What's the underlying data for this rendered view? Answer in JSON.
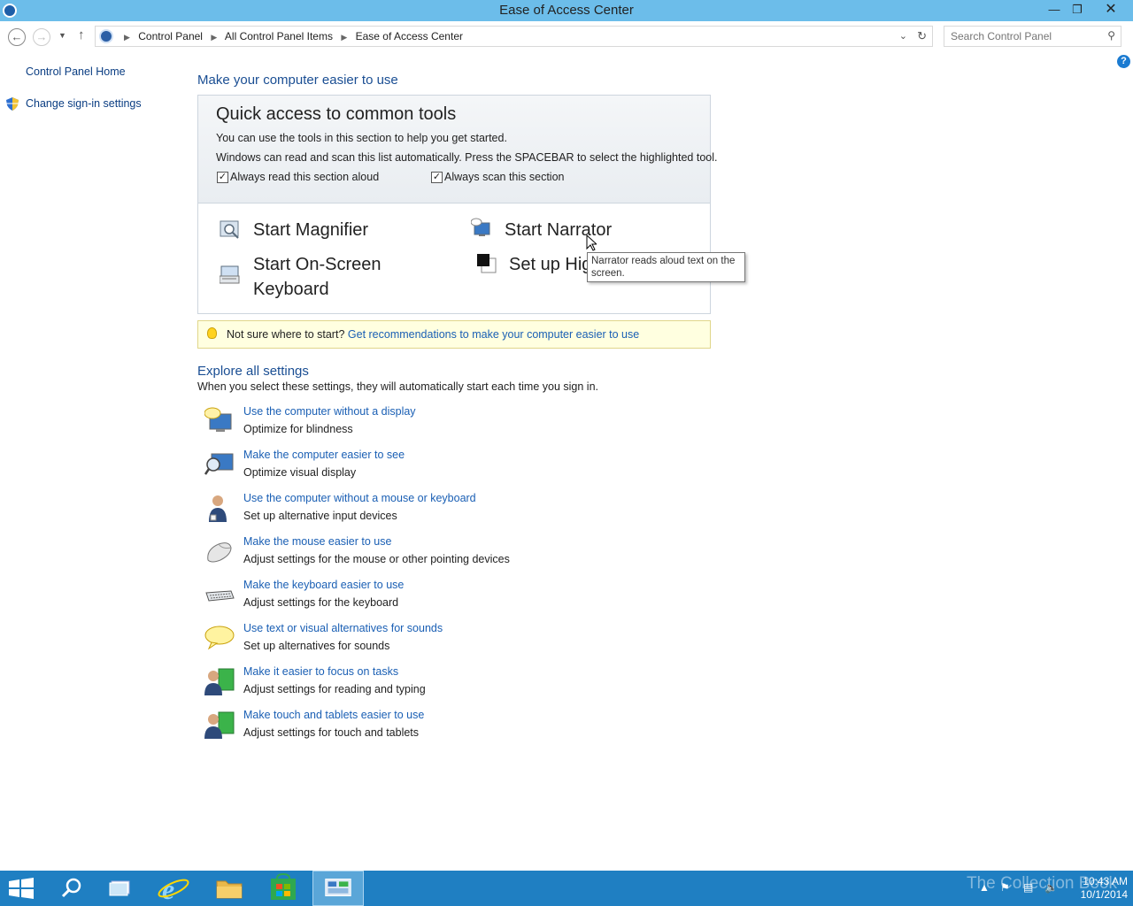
{
  "window": {
    "title": "Ease of Access Center"
  },
  "breadcrumbs": [
    "Control Panel",
    "All Control Panel Items",
    "Ease of Access Center"
  ],
  "search": {
    "placeholder": "Search Control Panel"
  },
  "left_pane": {
    "home": "Control Panel Home",
    "signin": "Change sign-in settings"
  },
  "main": {
    "heading": "Make your computer easier to use",
    "quick": {
      "title": "Quick access to common tools",
      "line1": "You can use the tools in this section to help you get started.",
      "line2": "Windows can read and scan this list automatically.  Press the SPACEBAR to select the highlighted tool.",
      "check_read": "Always read this section aloud",
      "check_scan": "Always scan this section",
      "tools": {
        "magnifier": "Start Magnifier",
        "narrator": "Start Narrator",
        "osk_line1": "Start On-Screen",
        "osk_line2": "Keyboard",
        "highcontrast": "Set up High Contrast"
      }
    },
    "tooltip": "Narrator reads aloud text on the screen.",
    "tip": {
      "prefix": "Not sure where to start?",
      "link": "Get recommendations to make your computer easier to use"
    },
    "explore": {
      "heading": "Explore all settings",
      "sub": "When you select these settings, they will automatically start each time you sign in.",
      "items": [
        {
          "link": "Use the computer without a display",
          "desc": "Optimize for blindness"
        },
        {
          "link": "Make the computer easier to see",
          "desc": "Optimize visual display"
        },
        {
          "link": "Use the computer without a mouse or keyboard",
          "desc": "Set up alternative input devices"
        },
        {
          "link": "Make the mouse easier to use",
          "desc": "Adjust settings for the mouse or other pointing devices"
        },
        {
          "link": "Make the keyboard easier to use",
          "desc": "Adjust settings for the keyboard"
        },
        {
          "link": "Use text or visual alternatives for sounds",
          "desc": "Set up alternatives for sounds"
        },
        {
          "link": "Make it easier to focus on tasks",
          "desc": "Adjust settings for reading and typing"
        },
        {
          "link": "Make touch and tablets easier to use",
          "desc": "Adjust settings for touch and tablets"
        }
      ]
    }
  },
  "taskbar": {
    "time": "10:43 AM",
    "date": "10/1/2014",
    "watermark": "The Collection Book"
  },
  "colors": {
    "titlebar": "#6cbdea",
    "taskbar": "#1f7fc2",
    "link": "#1a5fb4",
    "heading": "#1a4e93"
  }
}
